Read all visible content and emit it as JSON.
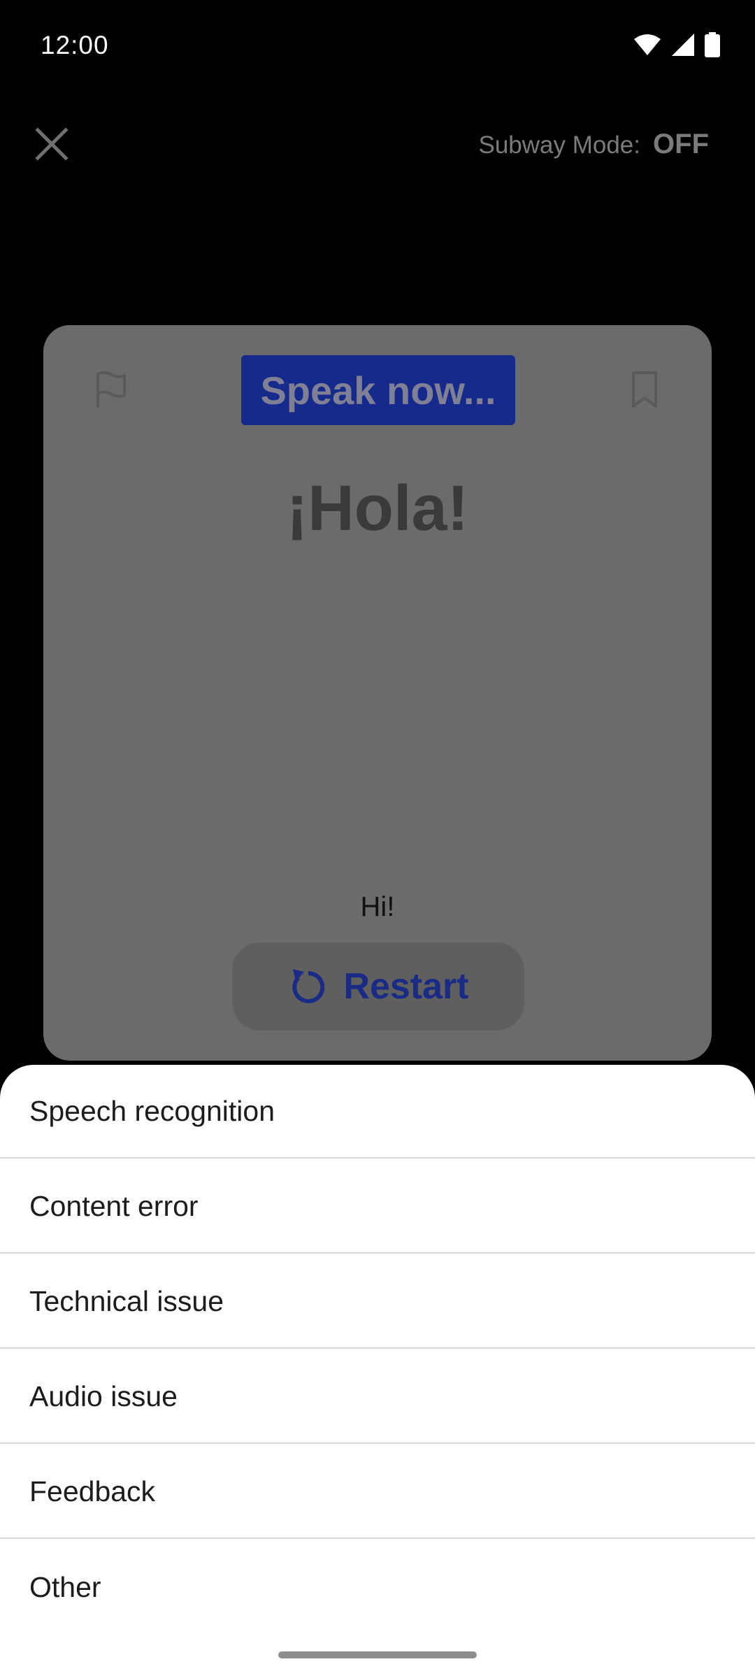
{
  "status_bar": {
    "time": "12:00",
    "icons": [
      "wifi-icon",
      "signal-icon",
      "battery-icon"
    ]
  },
  "header": {
    "close_icon": "close-icon",
    "subway_label": "Subway Mode:",
    "subway_value": "OFF"
  },
  "card": {
    "flag_icon": "flag-icon",
    "bookmark_icon": "bookmark-icon",
    "speak_label": "Speak now...",
    "prompt": "¡Hola!",
    "translation": "Hi!",
    "restart_label": "Restart",
    "restart_icon": "restart-icon"
  },
  "sheet": {
    "items": [
      {
        "label": "Speech recognition"
      },
      {
        "label": "Content error"
      },
      {
        "label": "Technical issue"
      },
      {
        "label": "Audio issue"
      },
      {
        "label": "Feedback"
      },
      {
        "label": "Other"
      }
    ]
  },
  "colors": {
    "scrim_card": "#6b6b6b",
    "speak_chip": "#152a8a",
    "restart_text": "#1a2b86",
    "sheet_bg": "#ffffff"
  }
}
